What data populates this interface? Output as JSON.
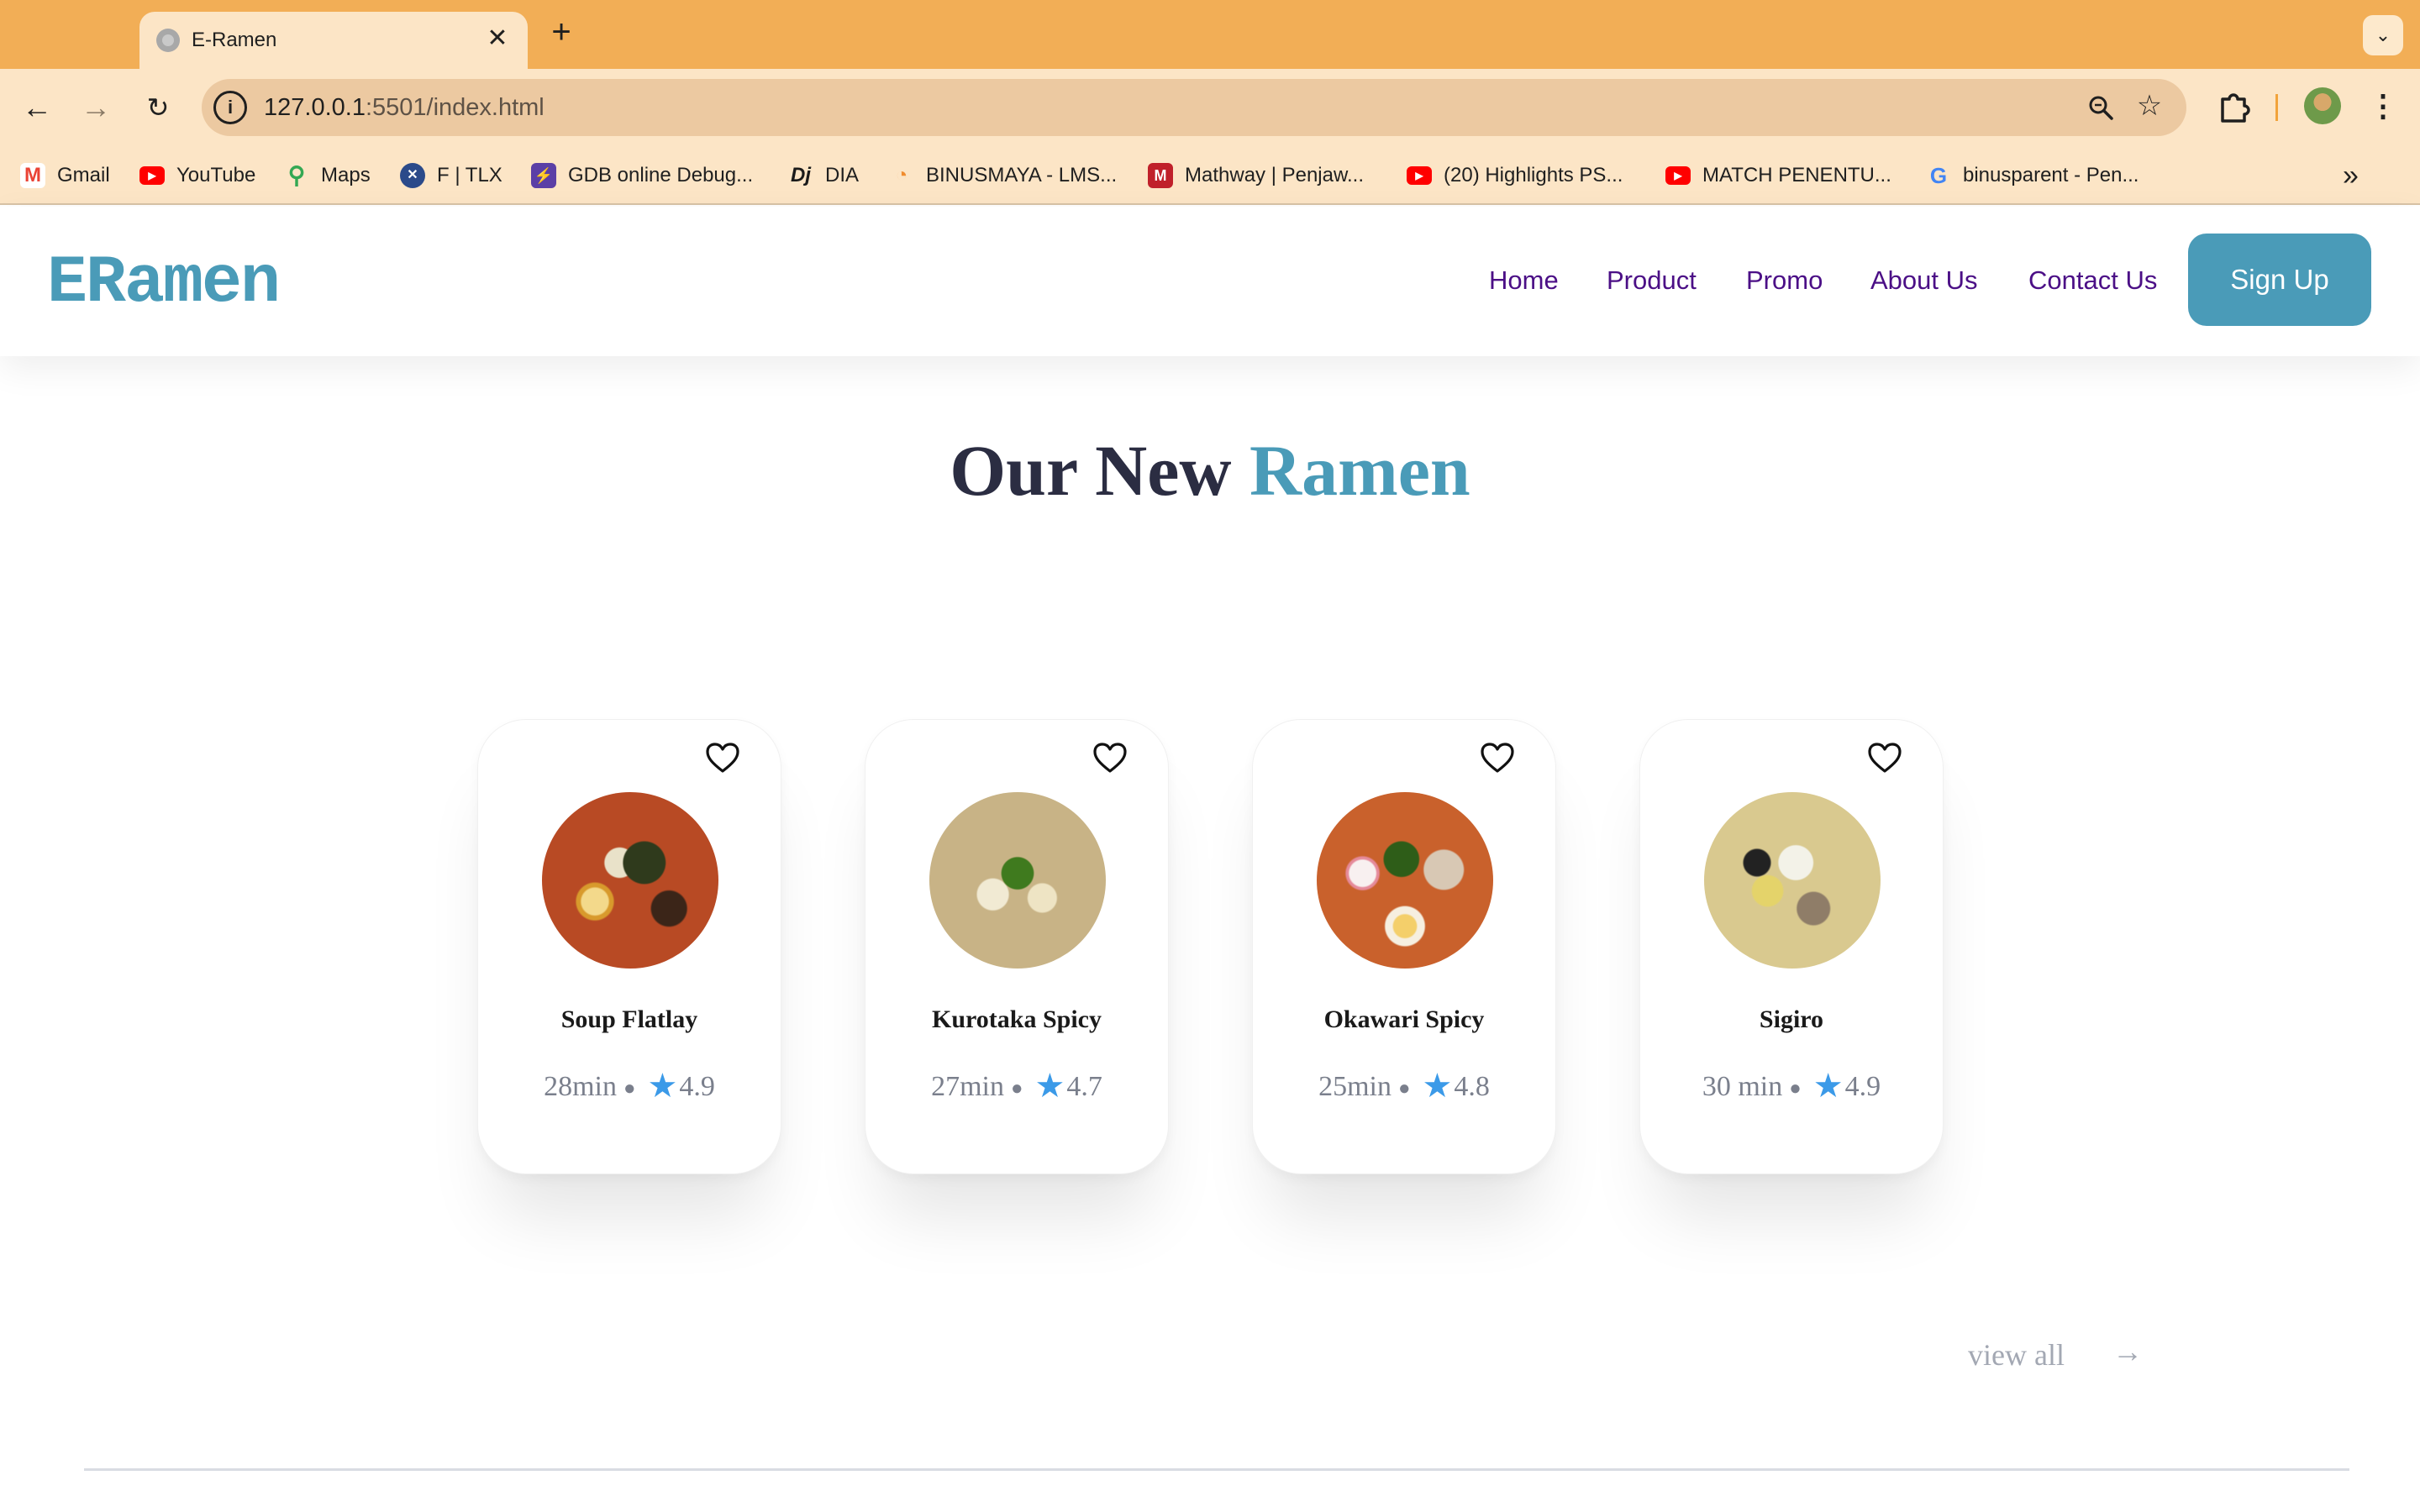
{
  "browser": {
    "tab_title": "E-Ramen",
    "tab_close": "✕",
    "new_tab": "+",
    "url_host": "127.0.0.1",
    "url_rest": ":5501/index.html",
    "bookmarks": [
      {
        "label": "Gmail",
        "icon": "gmail-icon",
        "color": "#ea4335"
      },
      {
        "label": "YouTube",
        "icon": "youtube-icon",
        "color": "#ff0000"
      },
      {
        "label": "Maps",
        "icon": "maps-icon",
        "color": "#34a853"
      },
      {
        "label": "F | TLX",
        "icon": "tlx-icon",
        "color": "#2b4a8a"
      },
      {
        "label": "GDB online Debug...",
        "icon": "gdb-icon",
        "color": "#5b3fa6"
      },
      {
        "label": "DIA",
        "icon": "dia-icon",
        "color": "#1a1a1a"
      },
      {
        "label": "BINUSMAYA - LMS...",
        "icon": "binusmaya-icon",
        "color": "#f08c2e"
      },
      {
        "label": "Mathway | Penjaw...",
        "icon": "mathway-icon",
        "color": "#c0202a"
      },
      {
        "label": "(20) Highlights PS...",
        "icon": "youtube-icon",
        "color": "#ff0000"
      },
      {
        "label": "MATCH PENENTU...",
        "icon": "youtube-icon",
        "color": "#ff0000"
      },
      {
        "label": "binusparent - Pen...",
        "icon": "google-icon",
        "color": "#4285f4"
      }
    ],
    "bookmarks_more": "»"
  },
  "site": {
    "logo": "ERamen",
    "nav": [
      "Home",
      "Product",
      "Promo",
      "About Us",
      "Contact Us"
    ],
    "signup": "Sign Up",
    "section_title_main": "Our New ",
    "section_title_accent": "Ramen",
    "view_all": "view all",
    "view_all_arrow": "→",
    "colors": {
      "accent": "#4a9bb8",
      "nav": "#4b0f86",
      "title": "#2b2d42",
      "star": "#3b9ae8"
    }
  },
  "products": [
    {
      "name": "Soup Flatlay",
      "time": "28min",
      "rating": "4.9"
    },
    {
      "name": "Kurotaka Spicy",
      "time": "27min",
      "rating": "4.7"
    },
    {
      "name": "Okawari Spicy",
      "time": "25min",
      "rating": "4.8"
    },
    {
      "name": "Sigiro",
      "time": "30 min",
      "rating": "4.9"
    }
  ]
}
